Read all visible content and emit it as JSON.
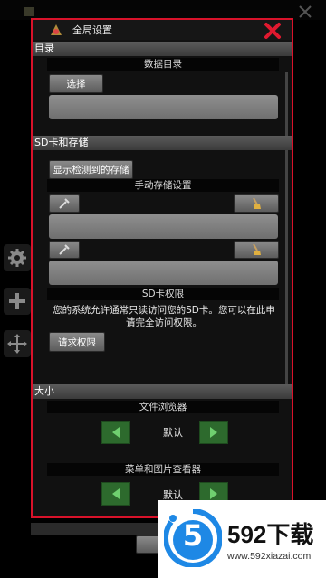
{
  "dialog": {
    "title": "全局设置"
  },
  "sections": {
    "directory": {
      "header": "目录",
      "label": "数据目录",
      "select_button": "选择"
    },
    "sd_storage": {
      "header": "SD卡和存储",
      "show_detected_button": "显示检测到的存储",
      "manual_label": "手动存储设置",
      "sd_permission_label": "SD卡权限",
      "permission_text_line1": "您的系统允许通常只读访问您的SD卡。您可以在此申",
      "permission_text_line2": "请完全访问权限。",
      "request_button": "请求权限"
    },
    "size": {
      "header": "大小",
      "file_browser_label": "文件浏览器",
      "file_browser_value": "默认",
      "menu_viewer_label": "菜单和图片查看器",
      "menu_viewer_value": "默认"
    }
  },
  "watermark": {
    "brand": "592下载",
    "url": "www.592xiazai.com",
    "logo_digit": "5"
  },
  "colors": {
    "dialog_border": "#d9122a",
    "close_x": "#e0192f",
    "section_header": "#4a4a4a",
    "arrow_green": "#2d6a2d",
    "logo_blue": "#1e88e5"
  }
}
